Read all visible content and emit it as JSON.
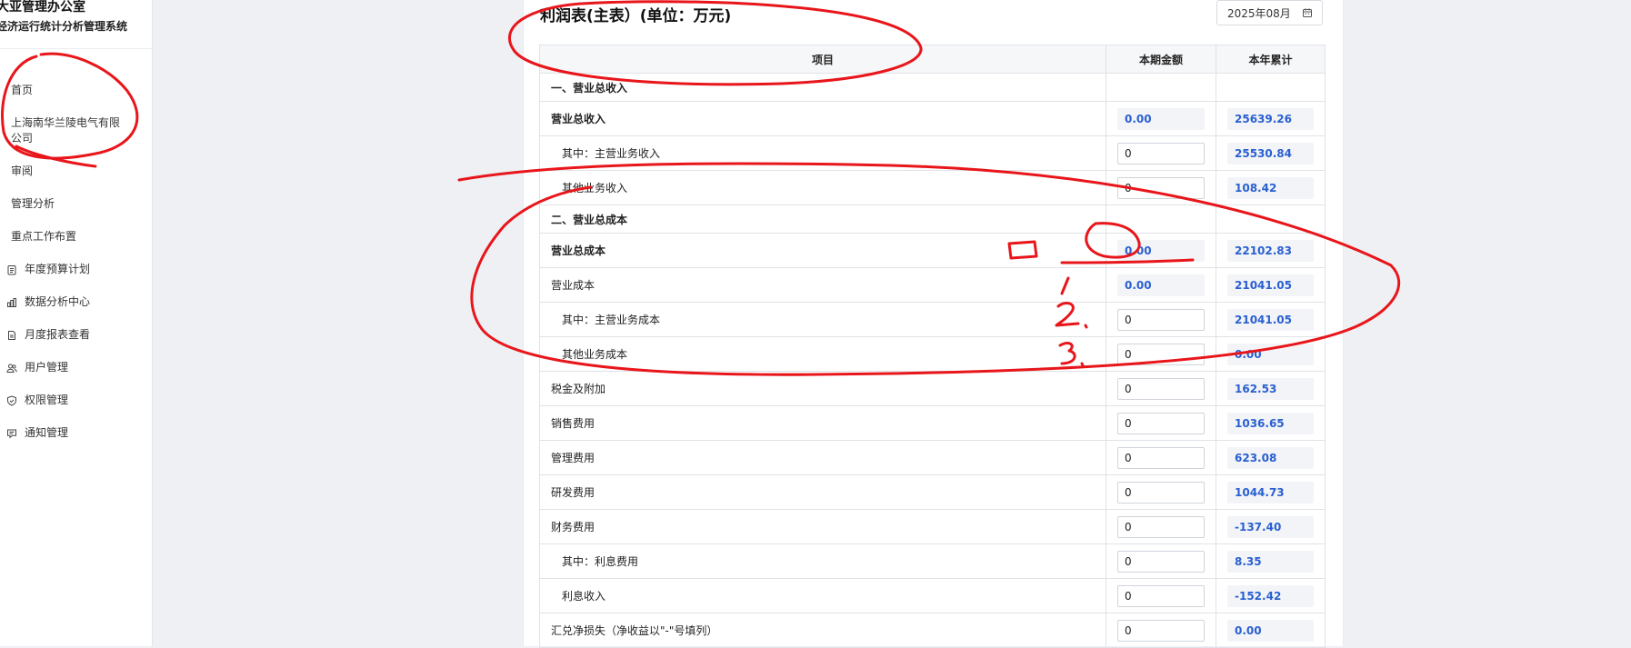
{
  "brand": {
    "title": "大亚管理办公室",
    "subtitle": "经济运行统计分析管理系统"
  },
  "sidebar": {
    "items": [
      {
        "label": "首页"
      },
      {
        "label": "上海南华兰陵电气有限公司"
      },
      {
        "label": "审阅"
      },
      {
        "label": "管理分析"
      },
      {
        "label": "重点工作布置"
      },
      {
        "label": "年度预算计划",
        "icon": "clipboard-icon"
      },
      {
        "label": "数据分析中心",
        "icon": "bar-chart-icon"
      },
      {
        "label": "月度报表查看",
        "icon": "document-icon"
      },
      {
        "label": "用户管理",
        "icon": "users-icon"
      },
      {
        "label": "权限管理",
        "icon": "shield-icon"
      },
      {
        "label": "通知管理",
        "icon": "message-icon"
      }
    ]
  },
  "page": {
    "title": "利润表(主表）(单位：万元)",
    "date": "2025年08月"
  },
  "table": {
    "headers": [
      "项目",
      "本期金额",
      "本年累计"
    ],
    "rows": [
      {
        "type": "section",
        "label": "一、营业总收入"
      },
      {
        "type": "bold",
        "label": "营业总收入",
        "current": "0.00",
        "current_kind": "value",
        "ytd": "25639.26"
      },
      {
        "type": "sub",
        "label": "其中：主营业务收入",
        "current": "0",
        "current_kind": "input",
        "ytd": "25530.84"
      },
      {
        "type": "sub",
        "label": "其他业务收入",
        "current": "0",
        "current_kind": "input",
        "ytd": "108.42"
      },
      {
        "type": "section",
        "label": "二、营业总成本"
      },
      {
        "type": "bold",
        "label": "营业总成本",
        "current": "0.00",
        "current_kind": "value",
        "ytd": "22102.83"
      },
      {
        "type": "normal",
        "label": "营业成本",
        "current": "0.00",
        "current_kind": "value",
        "ytd": "21041.05"
      },
      {
        "type": "sub",
        "label": "其中：主营业务成本",
        "current": "0",
        "current_kind": "input",
        "ytd": "21041.05"
      },
      {
        "type": "sub",
        "label": "其他业务成本",
        "current": "0",
        "current_kind": "input",
        "ytd": "0.00"
      },
      {
        "type": "normal",
        "label": "税金及附加",
        "current": "0",
        "current_kind": "input",
        "ytd": "162.53"
      },
      {
        "type": "normal",
        "label": "销售费用",
        "current": "0",
        "current_kind": "input",
        "ytd": "1036.65"
      },
      {
        "type": "normal",
        "label": "管理费用",
        "current": "0",
        "current_kind": "input",
        "ytd": "623.08"
      },
      {
        "type": "normal",
        "label": "研发费用",
        "current": "0",
        "current_kind": "input",
        "ytd": "1044.73"
      },
      {
        "type": "normal",
        "label": "财务费用",
        "current": "0",
        "current_kind": "input",
        "ytd": "-137.40"
      },
      {
        "type": "sub",
        "label": "其中：利息费用",
        "current": "0",
        "current_kind": "input",
        "ytd": "8.35"
      },
      {
        "type": "sub",
        "label": "利息收入",
        "current": "0",
        "current_kind": "input",
        "ytd": "-152.42"
      },
      {
        "type": "normal",
        "label": "汇兑净损失（净收益以\"-\"号填列）",
        "current": "0",
        "current_kind": "input",
        "ytd": "0.00"
      }
    ]
  },
  "annotation": {
    "color": "#e8161b",
    "marks": [
      "1",
      "2",
      "3"
    ]
  }
}
